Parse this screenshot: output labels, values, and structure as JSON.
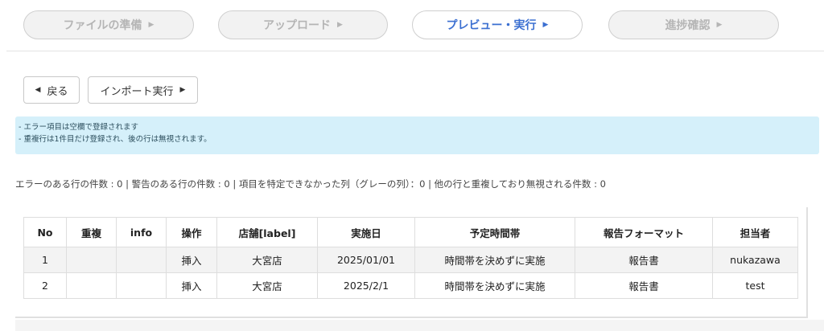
{
  "steps": [
    {
      "label": "ファイルの準備",
      "active": false
    },
    {
      "label": "アップロード",
      "active": false
    },
    {
      "label": "プレビュー・実行",
      "active": true
    },
    {
      "label": "進捗確認",
      "active": false
    }
  ],
  "actions": {
    "back_label": "戻る",
    "import_label": "インポート実行"
  },
  "alert": {
    "lines": [
      "- エラー項目は空欄で登録されます",
      "- 重複行は1件目だけ登録され、後の行は無視されます。"
    ]
  },
  "summary": "エラーのある行の件数 : 0 | 警告のある行の件数 : 0 | 項目を特定できなかった列（グレーの列）：0 | 他の行と重複しており無視される件数 : 0",
  "table": {
    "headers": [
      "No",
      "重複",
      "info",
      "操作",
      "店舗[label]",
      "実施日",
      "予定時間帯",
      "報告フォーマット",
      "担当者"
    ],
    "rows": [
      [
        "1",
        "",
        "",
        "挿入",
        "大宮店",
        "2025/01/01",
        "時間帯を決めずに実施",
        "報告書",
        "nukazawa"
      ],
      [
        "2",
        "",
        "",
        "挿入",
        "大宮店",
        "2025/2/1",
        "時間帯を決めずに実施",
        "報告書",
        "test"
      ]
    ]
  },
  "colors": {
    "active_step": "#3b6fd1",
    "alert_bg": "#d5f0fa"
  }
}
